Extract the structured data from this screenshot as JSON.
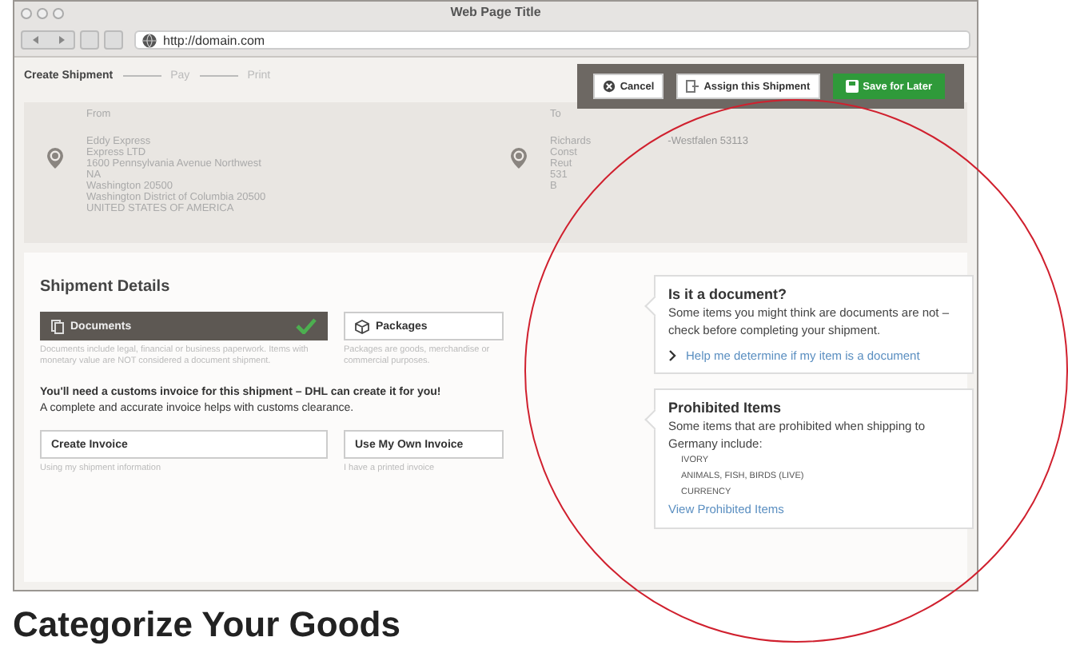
{
  "window": {
    "title": "Web Page Title",
    "url": "http://domain.com"
  },
  "steps": [
    {
      "label": "Create Shipment",
      "selected": true
    },
    {
      "label": "Pay",
      "selected": false
    },
    {
      "label": "Print",
      "selected": false
    }
  ],
  "actions": [
    {
      "label": "Cancel",
      "kind": "cancel"
    },
    {
      "label": "Assign this Shipment",
      "kind": "assign"
    },
    {
      "label": "Save for Later",
      "kind": "save"
    }
  ],
  "from": {
    "label": "From",
    "lines": [
      "Eddy Express",
      "Express LTD",
      "1600 Pennsylvania Avenue Northwest",
      "NA",
      "Washington 20500",
      "Washington District of Columbia 20500",
      "UNITED STATES OF AMERICA"
    ]
  },
  "to": {
    "label": "To",
    "lines": [
      "Richards",
      "Const",
      "Reut",
      "531",
      "B"
    ],
    "fragment": "-Westfalen 53113"
  },
  "shipment_details": {
    "title": "Shipment Details",
    "types": [
      {
        "label": "Documents",
        "selected": true,
        "kind": "documents",
        "description": "Documents include legal, financial or business paperwork. Items with monetary value are NOT considered a document shipment."
      },
      {
        "label": "Packages",
        "selected": false,
        "kind": "packages",
        "description": "Packages are goods, merchandise or commercial purposes."
      }
    ],
    "notice": "You'll need a customs invoice for this shipment – DHL can create it for you!",
    "notice_detail": "A complete and accurate invoice helps with customs clearance.",
    "invoice_options": [
      {
        "label": "Create Invoice",
        "description": "Using my shipment information"
      },
      {
        "label": "Use My Own Invoice",
        "description": "I have a printed invoice"
      }
    ]
  },
  "help": [
    {
      "title": "Is it a document?",
      "text": "Some items you might think are documents are not – check before completing your shipment.",
      "link": "Help me determine if my item is a document"
    },
    {
      "title": "Prohibited Items",
      "text": "Some items that are prohibited when shipping to Germany include:",
      "list": [
        "IVORY",
        "ANIMALS, FISH, BIRDS (LIVE)",
        "CURRENCY"
      ],
      "link": "View Prohibited Items"
    }
  ],
  "footer_heading": "Categorize Your Goods"
}
